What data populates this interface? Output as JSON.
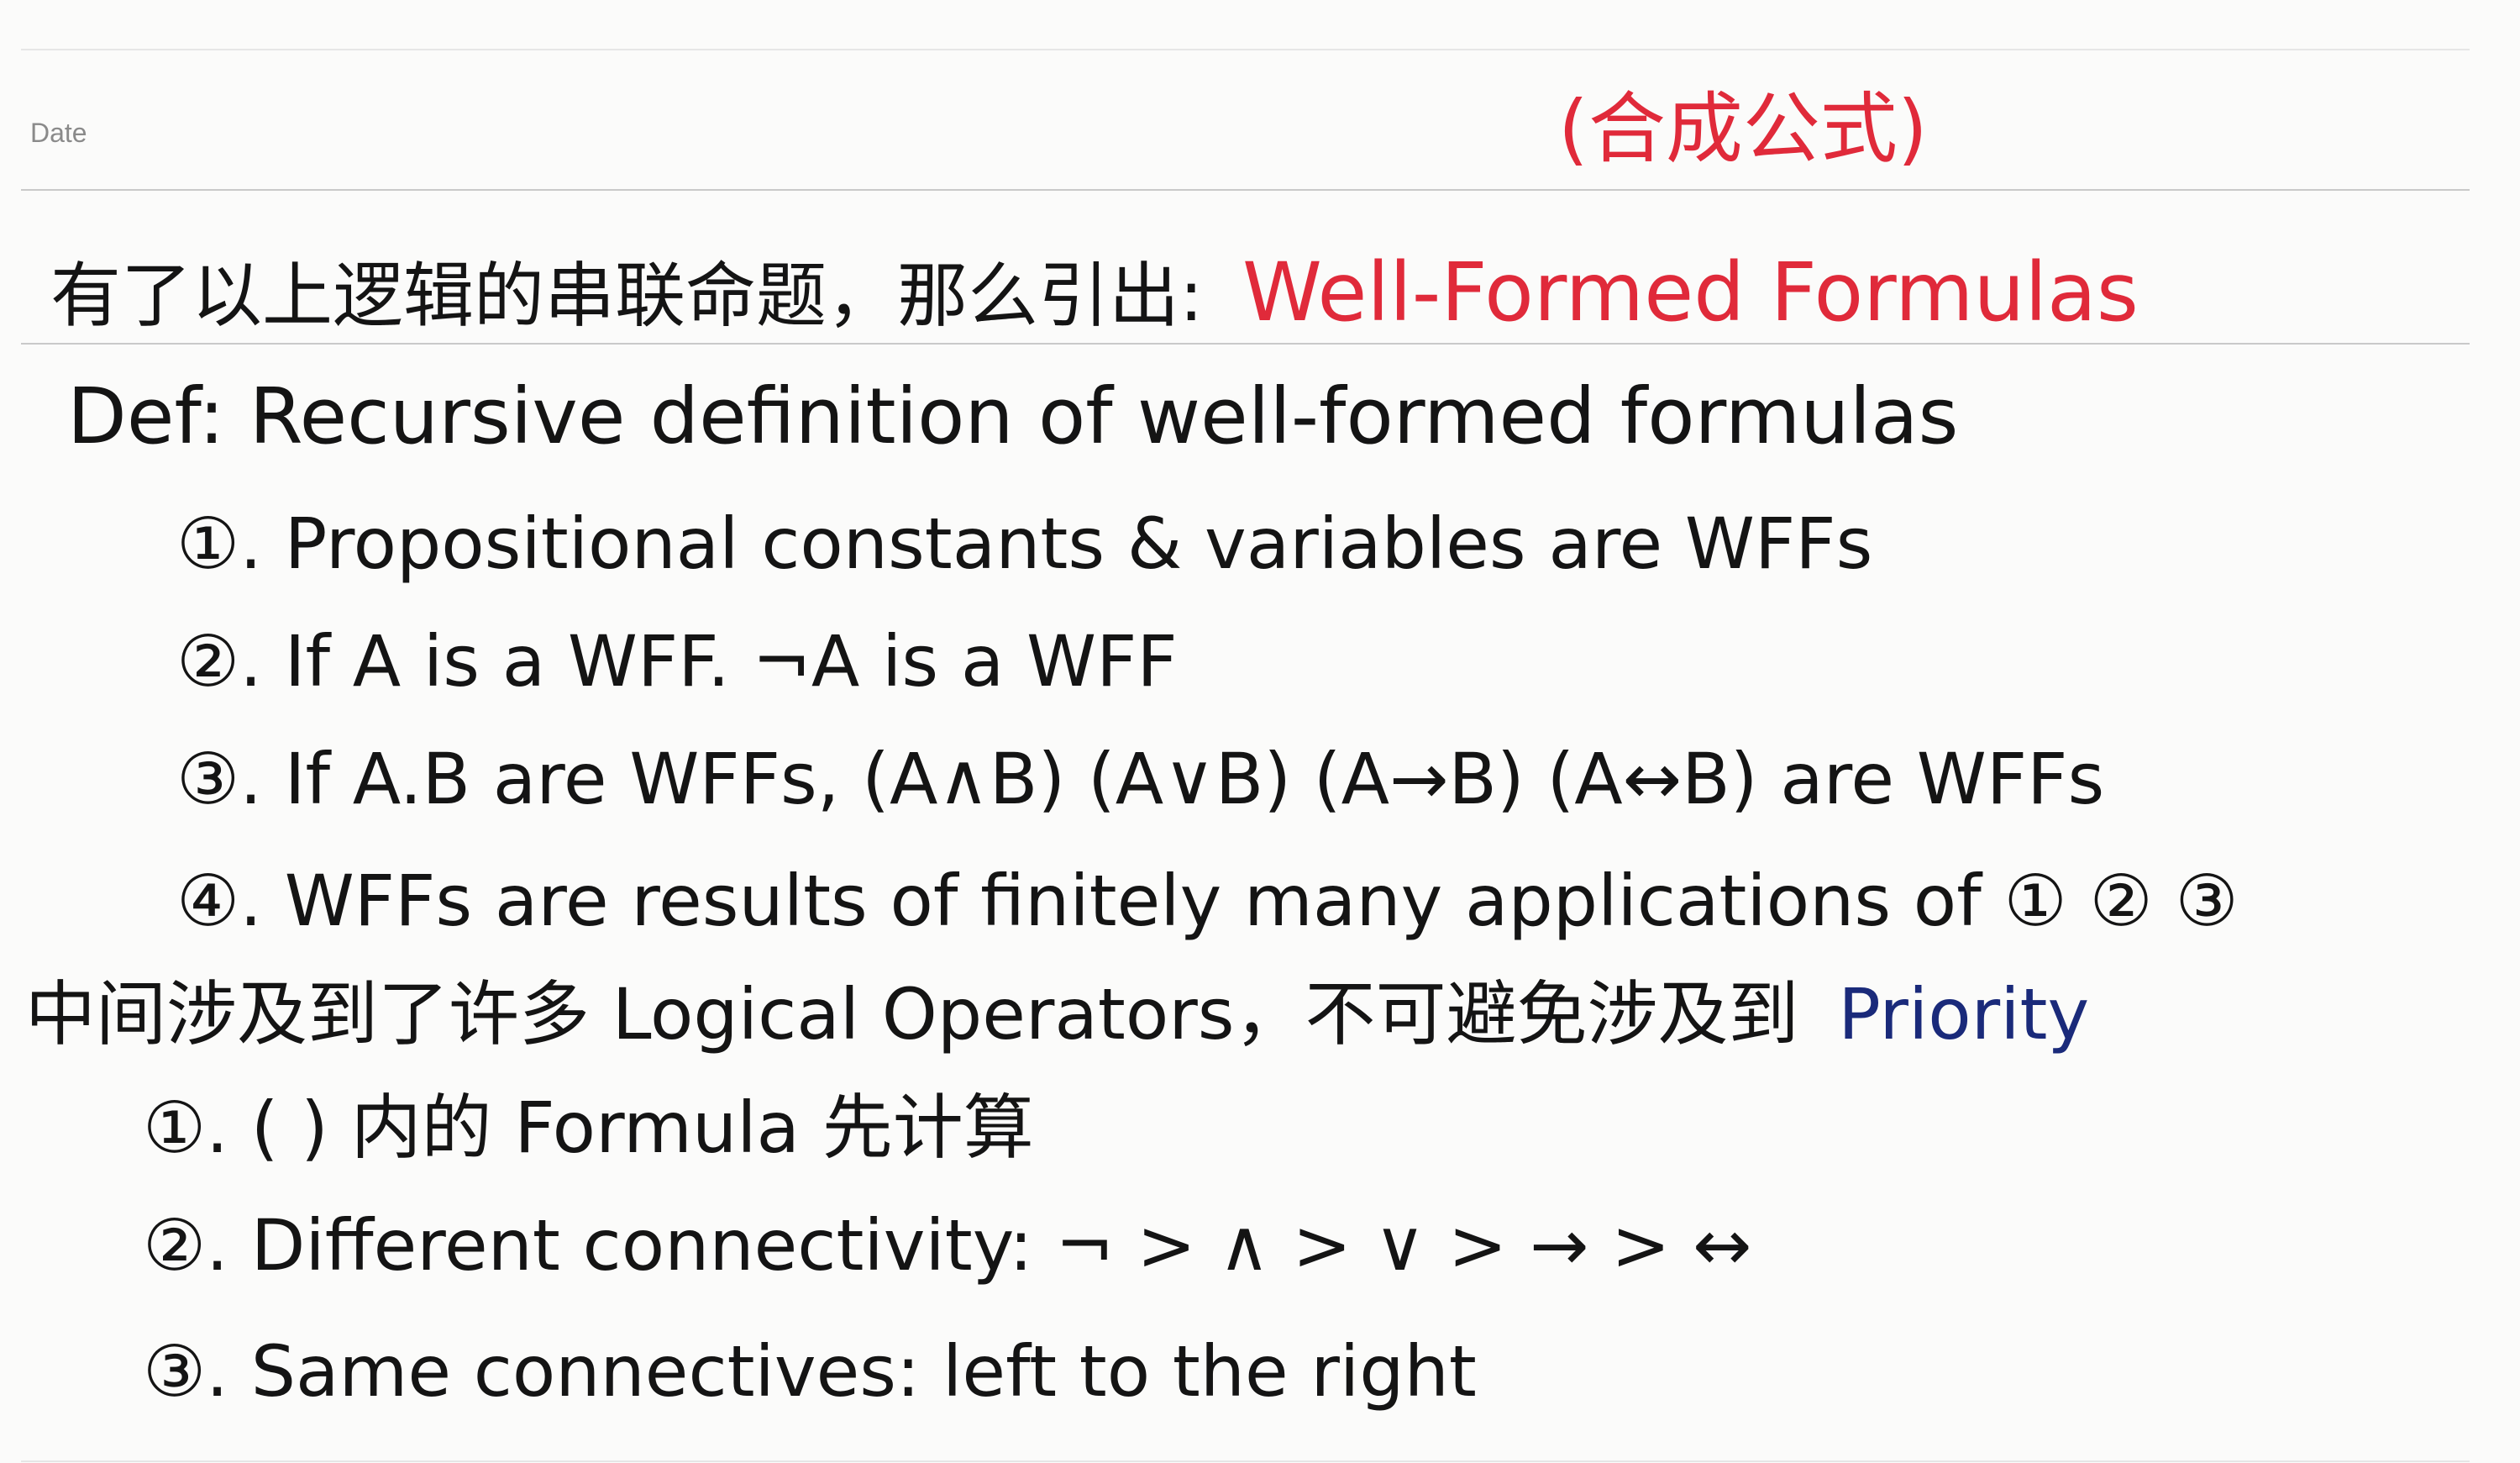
{
  "header": {
    "date_label": "Date",
    "top_note": "(合成公式)"
  },
  "intro": {
    "text": "有了以上逻辑的串联命题，那么引出:",
    "highlight": "Well-Formed Formulas"
  },
  "definition": {
    "title": "Def: Recursive definition of well-formed formulas",
    "items": [
      "①. Propositional constants & variables are WFFs",
      "②. If A is a WFF. ¬A is a WFF",
      "③. If A.B are WFFs, (A∧B) (A∨B) (A→B) (A↔B) are WFFs",
      "④. WFFs are results of finitely many applications of ① ② ③"
    ]
  },
  "priority": {
    "intro": "中间涉及到了许多 Logical Operators，不可避免涉及到",
    "highlight": "Priority",
    "items": [
      "①. ( ) 内的 Formula 先计算",
      "②. Different connectivity: ¬ > ∧ > ∨ > → > ↔",
      "③. Same connectives: left to the right"
    ]
  },
  "colors": {
    "ink": "#141414",
    "red_ink": "#e02a3a",
    "blue_ink": "#1a2a7a",
    "paper": "#fbfbfa",
    "rule": "#c9c9c9"
  }
}
